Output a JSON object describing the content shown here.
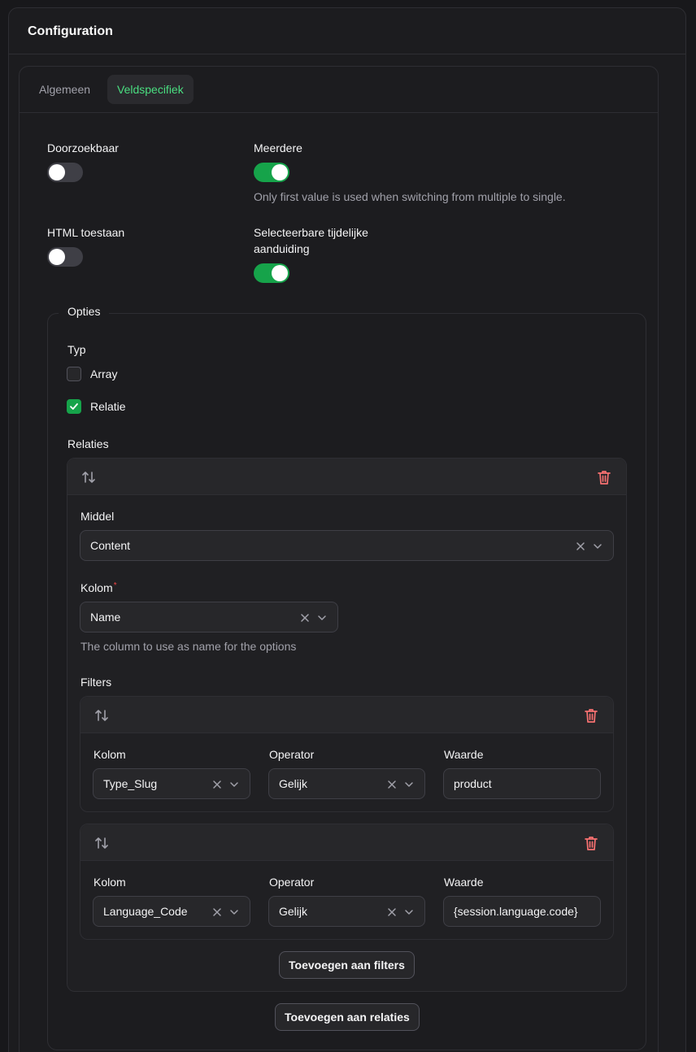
{
  "header": {
    "title": "Configuration"
  },
  "tabs": [
    {
      "label": "Algemeen",
      "active": false
    },
    {
      "label": "Veldspecifiek",
      "active": true
    }
  ],
  "toggles": {
    "searchable": {
      "label": "Doorzoekbaar",
      "on": false
    },
    "multiple": {
      "label": "Meerdere",
      "on": true,
      "hint": "Only first value is used when switching from multiple to single."
    },
    "allow_html": {
      "label": "HTML toestaan",
      "on": false
    },
    "selectable_placeholder": {
      "label_line1": "Selecteerbare tijdelijke",
      "label_line2": "aanduiding",
      "on": true
    }
  },
  "options": {
    "legend": "Opties",
    "type_label": "Typ",
    "type_options": [
      {
        "label": "Array",
        "checked": false
      },
      {
        "label": "Relatie",
        "checked": true
      }
    ],
    "relations_label": "Relaties",
    "relation": {
      "resource_label": "Middel",
      "resource_value": "Content",
      "column_label": "Kolom",
      "column_required_mark": "*",
      "column_value": "Name",
      "column_hint": "The column to use as name for the options",
      "filters_label": "Filters",
      "filters": [
        {
          "column_label": "Kolom",
          "column_value": "Type_Slug",
          "operator_label": "Operator",
          "operator_value": "Gelijk",
          "value_label": "Waarde",
          "value": "product"
        },
        {
          "column_label": "Kolom",
          "column_value": "Language_Code",
          "operator_label": "Operator",
          "operator_value": "Gelijk",
          "value_label": "Waarde",
          "value": "{session.language.code}"
        }
      ],
      "add_filter_label": "Toevoegen aan filters"
    },
    "add_relation_label": "Toevoegen aan relaties"
  },
  "colors": {
    "accent": "#16a34a",
    "active_tab_text": "#4ade80",
    "danger": "#f87171"
  },
  "icons": [
    "sort-arrows-icon",
    "trash-icon",
    "clear-x-icon",
    "chevron-down-icon",
    "check-icon"
  ]
}
